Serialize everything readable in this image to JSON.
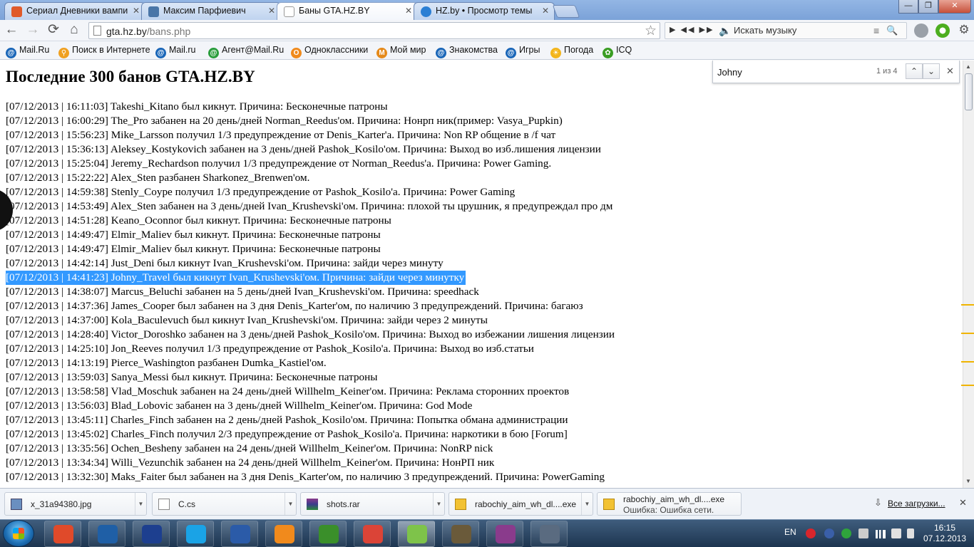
{
  "tabs": [
    {
      "title": "Сериал Дневники вампи",
      "favicon_color": "#e05a2a"
    },
    {
      "title": "Максим Парфиевич",
      "favicon_color": "#4a76a8"
    },
    {
      "title": "Баны GTA.HZ.BY",
      "favicon_color": "#ffffff"
    },
    {
      "title": "HZ.by • Просмотр темы",
      "favicon_color": "#2a7fd4"
    }
  ],
  "window_controls": {
    "minimize": "—",
    "maximize": "❐",
    "close": "✕"
  },
  "toolbar": {
    "back_icon": "←",
    "forward_icon": "→",
    "reload_icon": "⟳",
    "home_icon": "⌂",
    "url_host": "gta.hz.by",
    "url_path": "/bans.php",
    "bookmark_star": "☆",
    "music_controls": "▶ ◀◀ ▶▶",
    "music_placeholder": "Искать музыку"
  },
  "bookmarks": [
    {
      "label": "Mail.Ru",
      "icon": "@",
      "color": "#1a66b8"
    },
    {
      "label": "Поиск в Интернете",
      "icon": "🔎",
      "color": "#f0a020"
    },
    {
      "label": "Mail.ru",
      "icon": "@",
      "color": "#1a66b8"
    },
    {
      "label": "Агент@Mail.Ru",
      "icon": "@",
      "color": "#2a9d3c"
    },
    {
      "label": "Одноклассники",
      "icon": "O",
      "color": "#f08a1c"
    },
    {
      "label": "Мой мир",
      "icon": "M",
      "color": "#e58a1b"
    },
    {
      "label": "Знакомства",
      "icon": "@",
      "color": "#1a66b8"
    },
    {
      "label": "Игры",
      "icon": "@",
      "color": "#1a66b8"
    },
    {
      "label": "Погода",
      "icon": "☀",
      "color": "#f3b51b"
    },
    {
      "label": "ICQ",
      "icon": "✿",
      "color": "#3a9d23"
    }
  ],
  "page": {
    "title": "Последние 300 банов GTA.HZ.BY",
    "lines": [
      "[07/12/2013 | 16:11:03] Takeshi_Kitano был кикнут. Причина: Бесконечные патроны",
      "[07/12/2013 | 16:00:29] The_Pro забанен на 20 день/дней Norman_Reedus'ом. Причина: Нонрп ник(пример: Vasya_Pupkin)",
      "[07/12/2013 | 15:56:23] Mike_Larsson получил 1/3 предупреждение от Denis_Karter'a. Причина: Non RP общение в /f чат",
      "[07/12/2013 | 15:36:13] Aleksey_Kostykovich забанен на 3 день/дней Pashok_Kosilo'ом. Причина: Выход во изб.лишения лицензии",
      "[07/12/2013 | 15:25:04] Jeremy_Rechardson получил 1/3 предупреждение от Norman_Reedus'a. Причина: Power Gaming.",
      "[07/12/2013 | 15:22:22] Alex_Sten разбанен Sharkonez_Brenwen'ом.",
      "[07/12/2013 | 14:59:38] Stenly_Coype получил 1/3 предупреждение от Pashok_Kosilo'a. Причина: Power Gaming",
      "[07/12/2013 | 14:53:49] Alex_Sten забанен на 3 день/дней Ivan_Krushevski'ом. Причина: плохой ты црушник, я предупреждал про дм",
      "[07/12/2013 | 14:51:28] Keano_Oconnor был кикнут. Причина: Бесконечные патроны",
      "[07/12/2013 | 14:49:47] Elmir_Maliev был кикнут. Причина: Бесконечные патроны",
      "[07/12/2013 | 14:49:47] Elmir_Maliev был кикнут. Причина: Бесконечные патроны",
      "[07/12/2013 | 14:42:14] Just_Deni был кикнут Ivan_Krushevski'ом. Причина: зайди через минуту",
      "[07/12/2013 | 14:41:23] Johny_Travel был кикнут Ivan_Krushevski'ом. Причина: зайди через минутку",
      "[07/12/2013 | 14:38:07] Marcus_Beluchi забанен на 5 день/дней Ivan_Krushevski'ом. Причина: speedhack",
      "[07/12/2013 | 14:37:36] James_Cooper был забанен на 3 дня Denis_Karter'ом, по наличию 3 предупреждений. Причина: багаюз",
      "[07/12/2013 | 14:37:00] Kola_Baculevuch был кикнут Ivan_Krushevski'ом. Причина: зайди через 2 минуты",
      "[07/12/2013 | 14:28:40] Victor_Doroshko забанен на 3 день/дней Pashok_Kosilo'ом. Причина: Выход во избежании лишения лицензии",
      "[07/12/2013 | 14:25:10] Jon_Reeves получил 1/3 предупреждение от Pashok_Kosilo'a. Причина: Выход во изб.статьи",
      "[07/12/2013 | 14:13:19] Pierce_Washington разбанен Dumka_Kastiel'ом.",
      "[07/12/2013 | 13:59:03] Sanya_Messi был кикнут. Причина: Бесконечные патроны",
      "[07/12/2013 | 13:58:58] Vlad_Moschuk забанен на 24 день/дней Willhelm_Keiner'ом. Причина: Реклама сторонних проектов",
      "[07/12/2013 | 13:56:03] Blad_Lobovic забанен на 3 день/дней Willhelm_Keiner'ом. Причина: God Mode",
      "[07/12/2013 | 13:45:11] Charles_Finch забанен на 2 день/дней Pashok_Kosilo'ом. Причина: Попытка обмана администрации",
      "[07/12/2013 | 13:45:02] Charles_Finch получил 2/3 предупреждение от Pashok_Kosilo'a. Причина: наркотики в бою [Forum]",
      "[07/12/2013 | 13:35:56] Ochen_Besheny забанен на 24 день/дней Willhelm_Keiner'ом. Причина: NonRP nick",
      "[07/12/2013 | 13:34:34] Willi_Vezunchik забанен на 24 день/дней Willhelm_Keiner'ом. Причина: НонРП ник",
      "[07/12/2013 | 13:32:30] Maks_Faiter был забанен на 3 дня Denis_Karter'ом, по наличию 3 предупреждений. Причина: PowerGaming"
    ],
    "highlighted_line_index": 12
  },
  "findbar": {
    "query": "Johny",
    "count": "1 из 4",
    "prev_icon": "⌃",
    "next_icon": "⌄",
    "close_icon": "✕"
  },
  "downloads": {
    "items": [
      {
        "name": "x_31a94380.jpg",
        "status": "",
        "icon_color": "#6a8fc0"
      },
      {
        "name": "C.cs",
        "status": "",
        "icon_color": "#ffffff"
      },
      {
        "name": "shots.rar",
        "status": "",
        "icon_color": "#8a3b8c"
      },
      {
        "name": "rabochiy_aim_wh_dl....exe",
        "status": "",
        "icon_color": "#f2c233"
      },
      {
        "name": "rabochiy_aim_wh_dl....exe",
        "status": "Ошибка: Ошибка сети.",
        "icon_color": "#f2c233"
      }
    ],
    "show_all": "Все загрузки...",
    "close_icon": "✕"
  },
  "taskbar": {
    "apps": [
      {
        "name": "power-app",
        "color": "#e04a2a"
      },
      {
        "name": "shutdown-app",
        "color": "#1f5fa6"
      },
      {
        "name": "save-app",
        "color": "#1d3f8f"
      },
      {
        "name": "skype-app",
        "color": "#1aa3e6"
      },
      {
        "name": "word-app",
        "color": "#2b5ba8"
      },
      {
        "name": "avast-app",
        "color": "#f18a1c"
      },
      {
        "name": "game-app",
        "color": "#3a8f2a"
      },
      {
        "name": "chrome-app",
        "color": "#db4437"
      },
      {
        "name": "downloads-app",
        "color": "#7ec34a"
      },
      {
        "name": "gta-app",
        "color": "#6a5a3a"
      },
      {
        "name": "winrar-app",
        "color": "#8a3b8c"
      },
      {
        "name": "steam-app",
        "color": "#5a6b80"
      }
    ],
    "lang": "EN",
    "time": "16:15",
    "date": "07.12.2013"
  }
}
